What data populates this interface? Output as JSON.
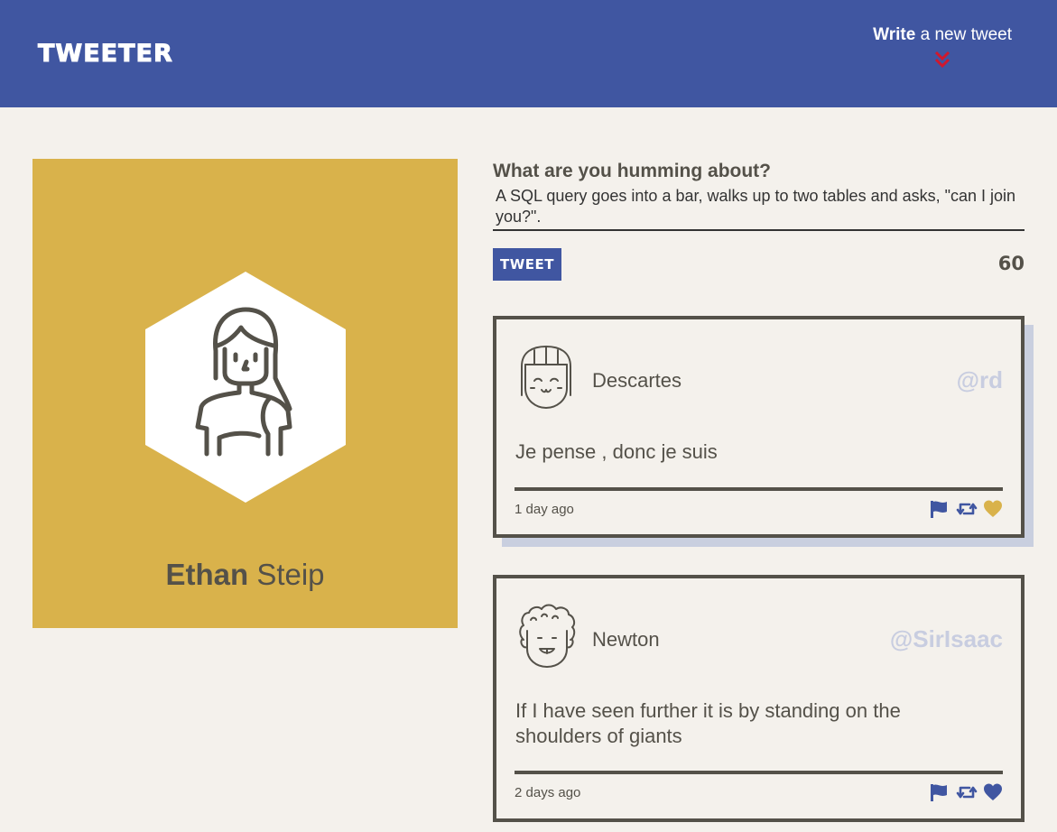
{
  "header": {
    "brand": "TWEETER",
    "compose_toggle": {
      "bold": "Write",
      "rest": " a new tweet",
      "icon": "double-chevron-down-icon"
    }
  },
  "colors": {
    "nav": "#4056a1",
    "accent_red": "#d0182d",
    "profile_bg": "#d9b24b",
    "page_bg": "#f4f1ec",
    "text": "#545149",
    "handle": "#c8cde0",
    "liked": "#d9b24b"
  },
  "profile": {
    "first_name": "Ethan",
    "last_name": "Steip",
    "avatar_icon": "user-avatar-icon"
  },
  "compose": {
    "label": "What are you humming about?",
    "value": "A SQL query goes into a bar, walks up to two tables and asks, \"can I join you?\".",
    "button": "TWEET",
    "counter": "60"
  },
  "tweets": [
    {
      "name": "Descartes",
      "handle": "@rd",
      "body": "Je pense , donc je suis",
      "time": "1 day ago",
      "liked": true,
      "icons": [
        "flag-icon",
        "retweet-icon",
        "heart-icon"
      ]
    },
    {
      "name": "Newton",
      "handle": "@SirIsaac",
      "body": "If I have seen further it is by standing on the shoulders of giants",
      "time": "2 days ago",
      "liked": false,
      "icons": [
        "flag-icon",
        "retweet-icon",
        "heart-icon"
      ]
    }
  ]
}
